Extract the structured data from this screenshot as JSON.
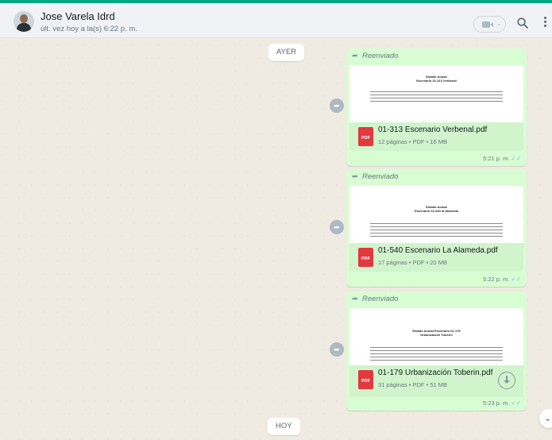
{
  "contact": {
    "name": "Jose Varela Idrd",
    "status": "últ. vez hoy a la(s) 6:22 p. m."
  },
  "icons": {
    "video": "video-call-icon",
    "search": "search-icon",
    "menu": "menu-icon",
    "forward": "forward-icon",
    "share": "share-icon",
    "download": "download-icon",
    "scroll": "chevron-down-icon"
  },
  "colors": {
    "accent": "#00a884",
    "bubble": "#d9fdd3",
    "pdf": "#e0393e",
    "read_ticks": "#53bdeb"
  },
  "chat": {
    "day_yesterday": "AYER",
    "day_today": "HOY",
    "messages": [
      {
        "forwarded": "Reenviado",
        "preview_title_1": "Estado Actual",
        "preview_title_2": "Escenario 01-313 Verbenal",
        "file_icon": "PDF",
        "file_name": "01-313 Escenario Verbenal.pdf",
        "file_meta": "12 páginas • PDF • 16 MB",
        "time": "5:21 p. m."
      },
      {
        "forwarded": "Reenviado",
        "preview_title_1": "Estado Actual",
        "preview_title_2": "Escenario 01-540 la Alameda",
        "file_icon": "PDF",
        "file_name": "01-540 Escenario La Alameda.pdf",
        "file_meta": "17 páginas • PDF • 20 MB",
        "time": "5:22 p. m."
      },
      {
        "forwarded": "Reenviado",
        "preview_title_1": "Estado Actual Escenario 01-179",
        "preview_title_2": "Urbanización Toberin",
        "file_icon": "PDF",
        "file_name": "01-179 Urbanización Toberin.pdf",
        "file_meta": "31 páginas • PDF • 51 MB",
        "time": "5:23 p. m."
      }
    ]
  }
}
